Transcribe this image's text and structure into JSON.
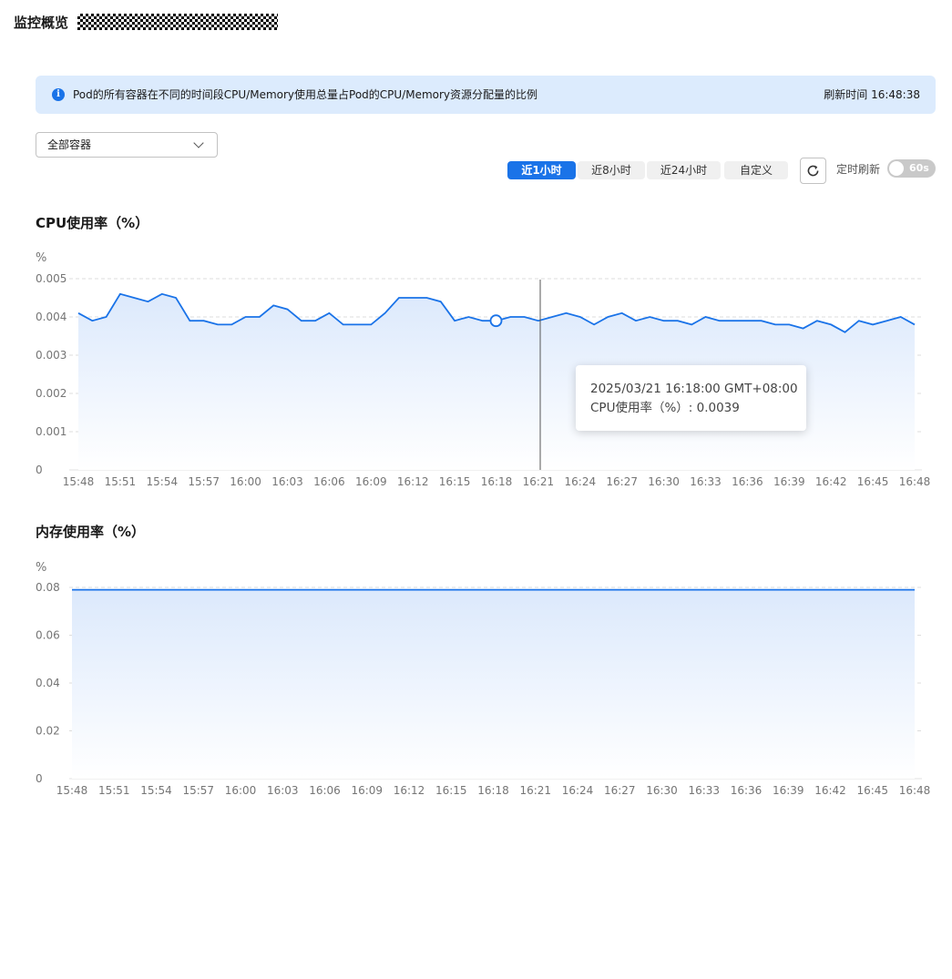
{
  "header": {
    "title": "监控概览"
  },
  "banner": {
    "icon": "info-icon",
    "text": "Pod的所有容器在不同的时间段CPU/Memory使用总量占Pod的CPU/Memory资源分配量的比例",
    "refresh_time": "刷新时间 16:48:38"
  },
  "container_select": {
    "value": "全部容器"
  },
  "time_range": {
    "tabs": [
      {
        "label": "近1小时",
        "active": true
      },
      {
        "label": "近8小时",
        "active": false
      },
      {
        "label": "近24小时",
        "active": false
      },
      {
        "label": "自定义",
        "active": false
      }
    ]
  },
  "auto_refresh": {
    "label": "定时刷新",
    "interval": "60s",
    "enabled": false
  },
  "colors": {
    "accent": "#1a73e8",
    "banner_bg": "#dcebfd",
    "line": "#1a73e8"
  },
  "tooltip": {
    "time": "2025/03/21 16:18:00 GMT+08:00",
    "value_label": "CPU使用率（%）: 0.0039"
  },
  "chart_data": [
    {
      "type": "area",
      "title": "CPU使用率（%）",
      "unit": "%",
      "ylim": [
        0,
        0.005
      ],
      "yticks": [
        "0",
        "0.001",
        "0.002",
        "0.003",
        "0.004",
        "0.005"
      ],
      "xticks": [
        "15:48",
        "15:51",
        "15:54",
        "15:57",
        "16:00",
        "16:03",
        "16:06",
        "16:09",
        "16:12",
        "16:15",
        "16:18",
        "16:21",
        "16:24",
        "16:27",
        "16:30",
        "16:33",
        "16:36",
        "16:39",
        "16:42",
        "16:45",
        "16:48"
      ],
      "grid": true,
      "hover_index": 30,
      "series": [
        {
          "values": [
            0.0041,
            0.0039,
            0.004,
            0.0046,
            0.0045,
            0.0044,
            0.0046,
            0.0045,
            0.0039,
            0.0039,
            0.0038,
            0.0038,
            0.004,
            0.004,
            0.0043,
            0.0042,
            0.0039,
            0.0039,
            0.0041,
            0.0038,
            0.0038,
            0.0038,
            0.0041,
            0.0045,
            0.0045,
            0.0045,
            0.0044,
            0.0039,
            0.004,
            0.0039,
            0.0039,
            0.004,
            0.004,
            0.0039,
            0.004,
            0.0041,
            0.004,
            0.0038,
            0.004,
            0.0041,
            0.0039,
            0.004,
            0.0039,
            0.0039,
            0.0038,
            0.004,
            0.0039,
            0.0039,
            0.0039,
            0.0039,
            0.0038,
            0.0038,
            0.0037,
            0.0039,
            0.0038,
            0.0036,
            0.0039,
            0.0038,
            0.0039,
            0.004,
            0.0038
          ]
        }
      ]
    },
    {
      "type": "area",
      "title": "内存使用率（%）",
      "unit": "%",
      "ylim": [
        0,
        0.08
      ],
      "yticks": [
        "0",
        "0.02",
        "0.04",
        "0.06",
        "0.08"
      ],
      "xticks": [
        "15:48",
        "15:51",
        "15:54",
        "15:57",
        "16:00",
        "16:03",
        "16:06",
        "16:09",
        "16:12",
        "16:15",
        "16:18",
        "16:21",
        "16:24",
        "16:27",
        "16:30",
        "16:33",
        "16:36",
        "16:39",
        "16:42",
        "16:45",
        "16:48"
      ],
      "grid": true,
      "series": [
        {
          "values": [
            0.079,
            0.079
          ]
        }
      ]
    }
  ]
}
